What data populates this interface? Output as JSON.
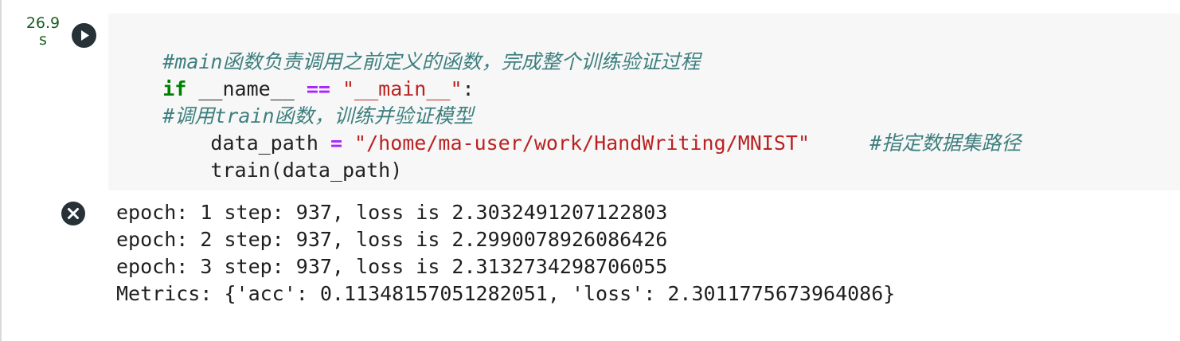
{
  "cell": {
    "execution_time": "26.9\ns",
    "run_icon": "play-circle-icon",
    "code": {
      "line1": {
        "comment": "#main函数负责调用之前定义的函数，完成整个训练验证过程"
      },
      "line2": {
        "keyword": "if",
        "name_var": " __name__ ",
        "operator": "==",
        "string": " \"__main__\"",
        "colon": ":"
      },
      "line3": {
        "comment": "#调用train函数，训练并验证模型"
      },
      "line4": {
        "indent_var": "    data_path ",
        "operator": "=",
        "string": " \"/home/ma-user/work/HandWriting/MNIST\"",
        "spacing": "     ",
        "comment": "#指定数据集路径"
      },
      "line5": {
        "text": "    train(data_path)"
      }
    }
  },
  "output": {
    "status_icon": "error-x-circle-icon",
    "lines": [
      "epoch: 1 step: 937, loss is 2.3032491207122803",
      "epoch: 2 step: 937, loss is 2.2990078926086426",
      "epoch: 3 step: 937, loss is 2.3132734298706055",
      "Metrics: {'acc': 0.11348157051282051, 'loss': 2.3011775673964086}"
    ]
  }
}
